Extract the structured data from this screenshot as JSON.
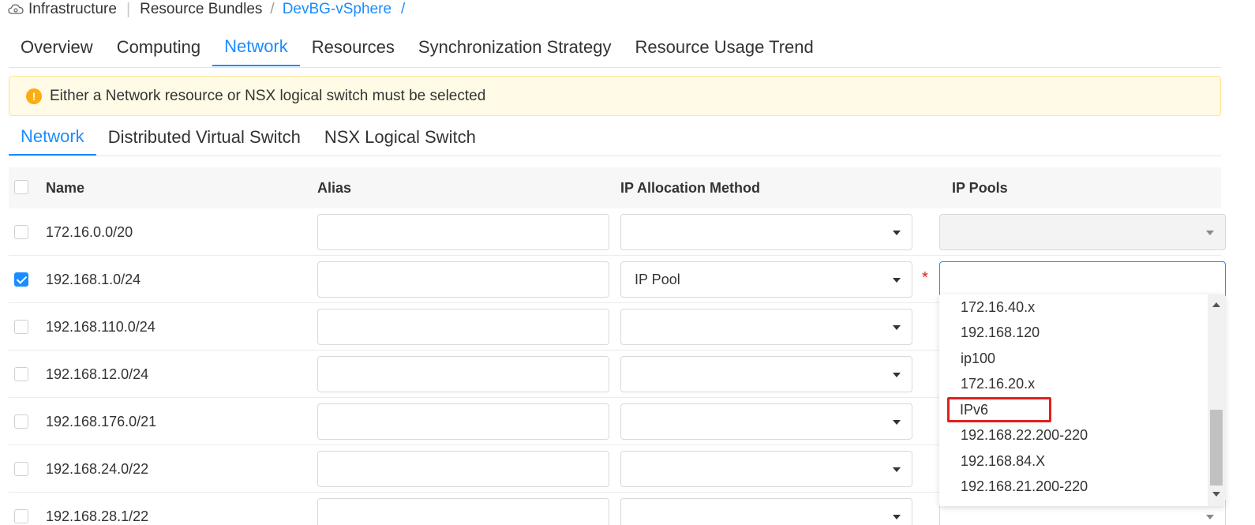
{
  "breadcrumb": {
    "root": "Infrastructure",
    "section": "Resource Bundles",
    "current": "DevBG-vSphere",
    "trailing_slash": "/"
  },
  "main_tabs": [
    {
      "label": "Overview",
      "active": false
    },
    {
      "label": "Computing",
      "active": false
    },
    {
      "label": "Network",
      "active": true
    },
    {
      "label": "Resources",
      "active": false
    },
    {
      "label": "Synchronization Strategy",
      "active": false
    },
    {
      "label": "Resource Usage Trend",
      "active": false
    }
  ],
  "alert": {
    "icon": "exclamation-icon",
    "message": "Either a Network resource or NSX logical switch must be selected"
  },
  "sub_tabs": [
    {
      "label": "Network",
      "active": true
    },
    {
      "label": "Distributed Virtual Switch",
      "active": false
    },
    {
      "label": "NSX Logical Switch",
      "active": false
    }
  ],
  "table": {
    "columns": {
      "name": "Name",
      "alias": "Alias",
      "ip_allocation": "IP Allocation Method",
      "ip_pools": "IP Pools"
    },
    "rows": [
      {
        "name": "172.16.0.0/20",
        "checked": false,
        "alias": "",
        "ip_allocation": ""
      },
      {
        "name": "192.168.1.0/24",
        "checked": true,
        "alias": "",
        "ip_allocation": "IP Pool"
      },
      {
        "name": "192.168.110.0/24",
        "checked": false,
        "alias": "",
        "ip_allocation": ""
      },
      {
        "name": "192.168.12.0/24",
        "checked": false,
        "alias": "",
        "ip_allocation": ""
      },
      {
        "name": "192.168.176.0/21",
        "checked": false,
        "alias": "",
        "ip_allocation": ""
      },
      {
        "name": "192.168.24.0/22",
        "checked": false,
        "alias": "",
        "ip_allocation": ""
      },
      {
        "name": "192.168.28.1/22",
        "checked": false,
        "alias": "",
        "ip_allocation": ""
      }
    ],
    "required_mark": "*"
  },
  "ip_pool_dropdown": {
    "options": [
      "172.16.40.x",
      "192.168.120",
      "ip100",
      "172.16.20.x",
      "IPv6",
      "192.168.22.200-220",
      "192.168.84.X",
      "192.168.21.200-220"
    ],
    "highlighted": "IPv6",
    "highlight_color": "#e02020"
  },
  "colors": {
    "accent": "#1a8cff",
    "warning": "#faad14",
    "alert_bg": "#fffbe6"
  }
}
